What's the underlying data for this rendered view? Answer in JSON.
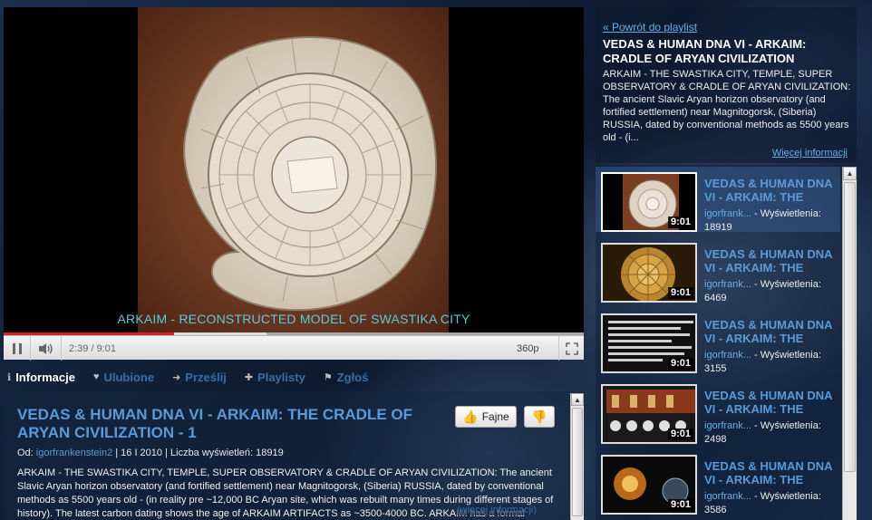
{
  "player": {
    "caption": "ARKAIM - RECONSTRUCTED MODEL OF SWASTIKA CITY",
    "current_time": "2:39",
    "duration": "9:01",
    "time_separator": " / ",
    "quality": "360p",
    "progress_fraction": 0.294
  },
  "tabs": [
    {
      "label": "Informacje",
      "icon": "info-icon",
      "glyph": "ℹ",
      "active": true
    },
    {
      "label": "Ulubione",
      "icon": "heart-icon",
      "glyph": "♥",
      "active": false
    },
    {
      "label": "Prześlij",
      "icon": "share-arrow-icon",
      "glyph": "➜",
      "active": false
    },
    {
      "label": "Playlisty",
      "icon": "plus-icon",
      "glyph": "✚",
      "active": false
    },
    {
      "label": "Zgłoś",
      "icon": "flag-icon",
      "glyph": "⚑",
      "active": false
    }
  ],
  "info": {
    "title": "VEDAS & HUMAN DNA VI - ARKAIM: THE CRADLE OF ARYAN CIVILIZATION - 1",
    "like_label": "Fajne",
    "meta_prefix": "Od: ",
    "author": "igorfrankenstein2",
    "meta_rest": " | 16 I 2010  | Liczba wyświetleń: 18919",
    "description": "ARKAIM - THE SWASTIKA CITY, TEMPLE, SUPER OBSERVATORY & CRADLE OF ARYAN CIVILIZATION: The ancient Slavic Aryan horizon observatory (and fortified settlement) near Magnitogorsk, (Siberia) RUSSIA, dated by conventional methods as 5500 years old - (in reality pre ~12,000 BC Aryan site, which was rebuilt many times during different stages of history). The latest carbon dating shows the age of ARKAIM ARTIFACTS as ~3500-4000 BC. ARKAIM has a formal layout.",
    "more_label": "(więcej informacji)"
  },
  "playlist_header": {
    "back_label": "« Powrót do playlist",
    "title": "VEDAS & HUMAN DNA VI - ARKAIM: CRADLE OF ARYAN CIVILIZATION",
    "description": "ARKAIM - THE SWASTIKA CITY, TEMPLE, SUPER OBSERVATORY & CRADLE OF ARYAN CIVILIZATION: The ancient Slavic Aryan horizon observatory (and fortified settlement) near Magnitogorsk, (Siberia) RUSSIA, dated by conventional methods as 5500 years old - (i...",
    "more_label": "Więcej informacji"
  },
  "playlist": [
    {
      "title": "VEDAS & HUMAN DNA VI - ARKAIM: THE",
      "author": "igorfrank...",
      "views_label": " - Wyświetlenia:",
      "views": "18919",
      "duration": "9:01",
      "current": true
    },
    {
      "title": "VEDAS & HUMAN DNA VI - ARKAIM: THE",
      "author": "igorfrank...",
      "views_label": " - Wyświetlenia:",
      "views": "6469",
      "duration": "9:01",
      "current": false
    },
    {
      "title": "VEDAS & HUMAN DNA VI - ARKAIM: THE",
      "author": "igorfrank...",
      "views_label": " - Wyświetlenia:",
      "views": "3155",
      "duration": "9:01",
      "current": false
    },
    {
      "title": "VEDAS & HUMAN DNA VI - ARKAIM: THE",
      "author": "igorfrank...",
      "views_label": " - Wyświetlenia:",
      "views": "2498",
      "duration": "9:01",
      "current": false
    },
    {
      "title": "VEDAS & HUMAN DNA VI - ARKAIM: THE",
      "author": "igorfrank...",
      "views_label": " - Wyświetlenia:",
      "views": "3586",
      "duration": "9:01",
      "current": false
    }
  ],
  "colors": {
    "accent_link": "#5b9ad8",
    "progress_played": "#e02020",
    "caption": "#5fc8d8"
  }
}
